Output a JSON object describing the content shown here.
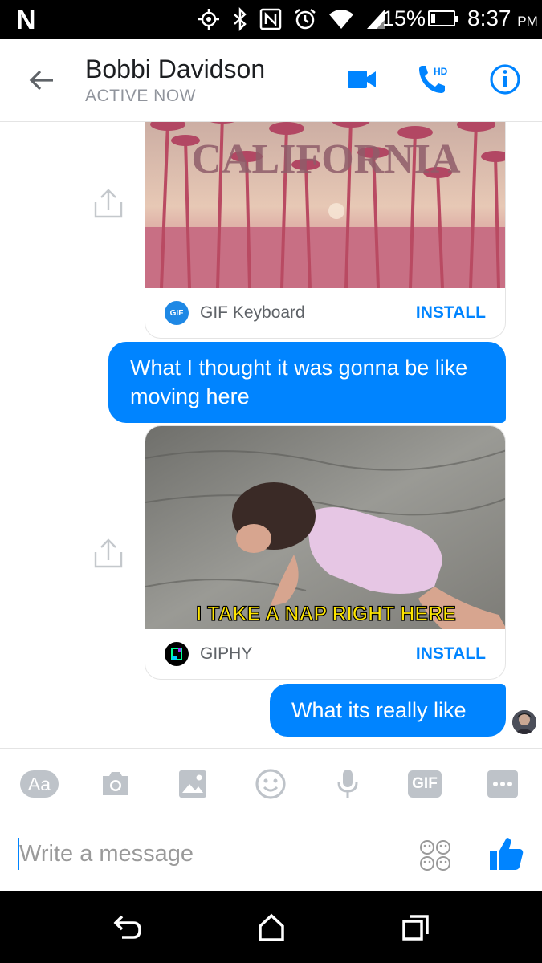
{
  "status_bar": {
    "carrier_logo": "N",
    "battery_percent": "15%",
    "time": "8:37",
    "ampm": "PM",
    "icons": [
      "gps-icon",
      "bluetooth-icon",
      "nfc-icon",
      "alarm-icon",
      "wifi-icon",
      "signal-icon",
      "battery-icon"
    ]
  },
  "header": {
    "contact_name": "Bobbi Davidson",
    "contact_status": "ACTIVE NOW",
    "call_badge": "HD",
    "accent": "#0084ff"
  },
  "thread": {
    "card1": {
      "gif_text": "CALIFORNIA",
      "app_icon_text": "GIF",
      "app_name": "GIF Keyboard",
      "install_label": "INSTALL"
    },
    "message1": "What I thought it was gonna be like moving here",
    "card2": {
      "caption": "I TAKE A NAP RIGHT HERE",
      "app_name": "GIPHY",
      "install_label": "INSTALL"
    },
    "message2": "What its really like"
  },
  "toolbar": {
    "text_mode_label": "Aa",
    "gif_label": "GIF"
  },
  "composer": {
    "placeholder": "Write a message"
  },
  "colors": {
    "bubble": "#0084ff",
    "header_icon": "#0084ff",
    "toolbar_icon": "#bec3c9"
  }
}
